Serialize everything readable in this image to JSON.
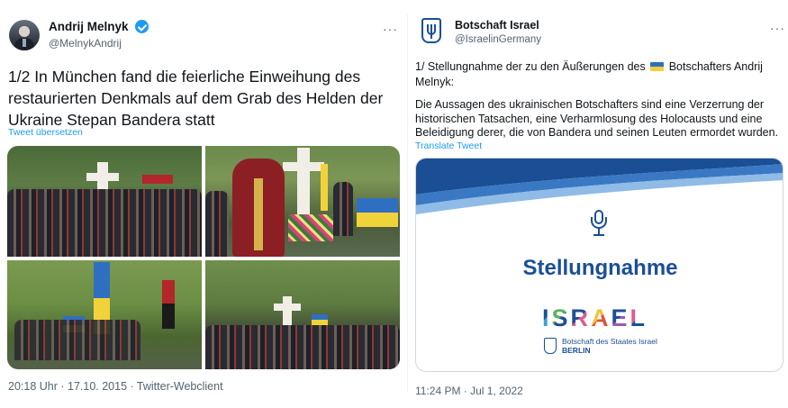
{
  "left_tweet": {
    "author_name": "Andrij Melnyk",
    "handle": "@MelnykAndrij",
    "more_label": "···",
    "text": "1/2 In München fand die feierliche Einweihung des restaurierten Denkmals auf dem Grab des Helden der Ukraine Stepan Bandera statt",
    "translate_label": "Tweet übersetzen",
    "timestamp": "20:18 Uhr · 17.10. 2015 · Twitter-Webclient",
    "photos": [
      "crowd-at-grave-photo",
      "priest-at-grave-photo",
      "procession-with-flags-photo",
      "crowd-at-memorial-photo"
    ]
  },
  "right_tweet": {
    "author_name": "Botschaft Israel",
    "handle": "@IsraelinGermany",
    "more_label": "···",
    "text_line1_before_flag": "1/ Stellungnahme der zu den Äußerungen des",
    "text_line1_after_flag": "Botschafters Andrij Melnyk:",
    "text_body": "Die Aussagen des ukrainischen Botschafters sind eine Verzerrung der historischen Tatsachen, eine Verharmlosung des Holocausts und eine Beleidigung derer, die von Bandera und seinen Leuten ermordet wurden.",
    "translate_label": "Translate Tweet",
    "card": {
      "title": "Stellungnahme",
      "logo_letters": [
        "I",
        "S",
        "R",
        "A",
        "E",
        "L"
      ],
      "embassy_line": "Botschaft des Staates Israel",
      "city": "BERLIN"
    },
    "timestamp": "11:24 PM · Jul 1, 2022"
  },
  "colors": {
    "link_blue": "#1d9bf0",
    "verified_blue": "#1d9bf0",
    "israel_blue": "#1b4f95",
    "muted_text": "#536471",
    "ukraine_blue": "#2f6fc2",
    "ukraine_yellow": "#f2d23a"
  },
  "icons": {
    "verified": "verified-badge-icon",
    "more": "more-options-icon",
    "microphone": "microphone-icon",
    "ukraine_flag": "ukraine-flag-emoji"
  }
}
